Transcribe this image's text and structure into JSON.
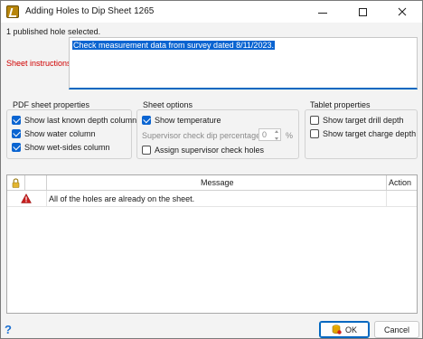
{
  "window": {
    "title": "Adding Holes to Dip Sheet 1265",
    "app_icon": "dip-sheet-app-icon"
  },
  "status": {
    "selected_count": "1 published hole selected."
  },
  "instructions": {
    "label": "Sheet instructions",
    "value": "Check measurement data from survey dated 8/11/2023."
  },
  "pdf_properties": {
    "title": "PDF sheet properties",
    "options": [
      {
        "label": "Show last known depth column",
        "checked": true
      },
      {
        "label": "Show water column",
        "checked": true
      },
      {
        "label": "Show wet-sides column",
        "checked": true
      }
    ]
  },
  "sheet_options": {
    "title": "Sheet options",
    "show_temperature": {
      "label": "Show temperature",
      "checked": true
    },
    "supervisor_pct": {
      "label": "Supervisor check dip percentage",
      "value": "0",
      "unit": "%"
    },
    "assign_supervisor": {
      "label": "Assign supervisor check holes",
      "checked": false
    }
  },
  "tablet_properties": {
    "title": "Tablet properties",
    "options": [
      {
        "label": "Show target drill depth",
        "checked": false
      },
      {
        "label": "Show target charge depth",
        "checked": false
      }
    ]
  },
  "grid": {
    "columns": {
      "lock_icon": "lock-icon",
      "message": "Message",
      "action": "Action"
    },
    "rows": [
      {
        "icon": "warning-icon",
        "message": "All of the holes are already on the sheet.",
        "action": ""
      }
    ]
  },
  "footer": {
    "help_icon": "help-icon",
    "ok_label": "OK",
    "cancel_label": "Cancel"
  },
  "colors": {
    "accent": "#0067c0",
    "selection": "#0a64d1",
    "required_label": "#d00000",
    "warning": "#c81e1e"
  }
}
